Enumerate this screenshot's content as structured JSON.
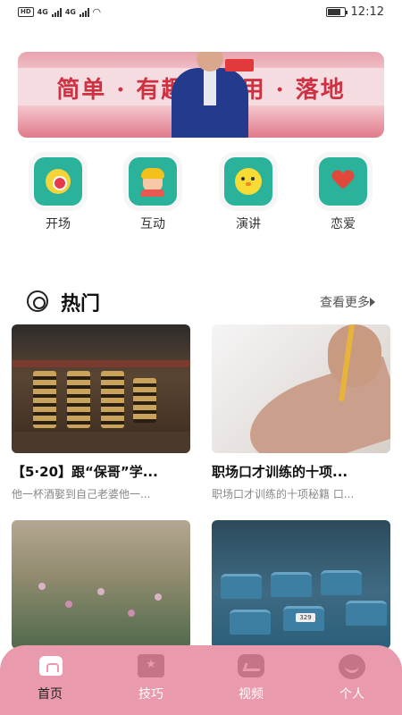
{
  "status_bar": {
    "hd": "HD",
    "net1": "4G",
    "net2": "4G",
    "time": "12:12"
  },
  "banner": {
    "text": "简单 · 有趣 · 实用 · 落地"
  },
  "categories": [
    {
      "label": "开场",
      "icon": "ball-icon"
    },
    {
      "label": "互动",
      "icon": "boy-face-icon"
    },
    {
      "label": "演讲",
      "icon": "chick-icon"
    },
    {
      "label": "恋爱",
      "icon": "heart-icon"
    }
  ],
  "section": {
    "title": "热门",
    "more": "查看更多"
  },
  "cards": [
    {
      "title": "【5·20】跟“保哥”学...",
      "subtitle": "他一杯酒娶到自己老婆他一..."
    },
    {
      "title": "职场口才训练的十项...",
      "subtitle": "职场口才训练的十项秘籍 口..."
    },
    {
      "title": "",
      "subtitle": ""
    },
    {
      "title": "",
      "subtitle": ""
    }
  ],
  "tabs": [
    {
      "label": "首页",
      "active": true
    },
    {
      "label": "技巧",
      "active": false
    },
    {
      "label": "视频",
      "active": false
    },
    {
      "label": "个人",
      "active": false
    }
  ],
  "colors": {
    "tabbar": "#e99aac",
    "category_bg": "#2bb29b",
    "banner_text": "#cf3143"
  }
}
